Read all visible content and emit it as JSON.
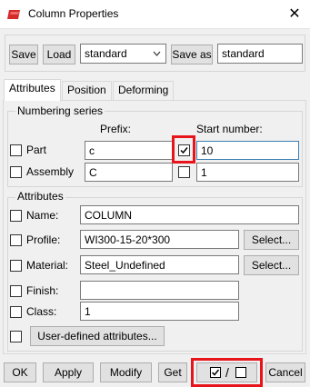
{
  "window": {
    "title": "Column Properties",
    "close_glyph": "✕",
    "app_icon": "tekla-red-icon"
  },
  "toolbar": {
    "save_label": "Save",
    "load_label": "Load",
    "load_combo_value": "standard",
    "save_as_label": "Save as",
    "save_as_value": "standard"
  },
  "tabs": [
    {
      "label": "Attributes",
      "active": true
    },
    {
      "label": "Position",
      "active": false
    },
    {
      "label": "Deforming",
      "active": false
    }
  ],
  "numbering": {
    "title": "Numbering series",
    "prefix_header": "Prefix:",
    "start_header": "Start number:",
    "rows": [
      {
        "label": "Part",
        "prefix": "c",
        "start_checked": true,
        "start": "10"
      },
      {
        "label": "Assembly",
        "prefix": "C",
        "start_checked": false,
        "start": "1"
      }
    ]
  },
  "attributes": {
    "title": "Attributes",
    "name": {
      "label": "Name:",
      "value": "COLUMN"
    },
    "profile": {
      "label": "Profile:",
      "value": "WI300-15-20*300",
      "select_label": "Select..."
    },
    "material": {
      "label": "Material:",
      "value": "Steel_Undefined",
      "select_label": "Select..."
    },
    "finish": {
      "label": "Finish:",
      "value": ""
    },
    "class": {
      "label": "Class:",
      "value": "1"
    },
    "uda_label": "User-defined attributes..."
  },
  "bottom": {
    "ok_label": "OK",
    "apply_label": "Apply",
    "modify_label": "Modify",
    "get_label": "Get",
    "toggle_separator": "/",
    "cancel_label": "Cancel"
  },
  "colors": {
    "highlight": "#e8141b",
    "window_bg": "#f0f0f0",
    "button_bg": "#e1e1e1"
  }
}
